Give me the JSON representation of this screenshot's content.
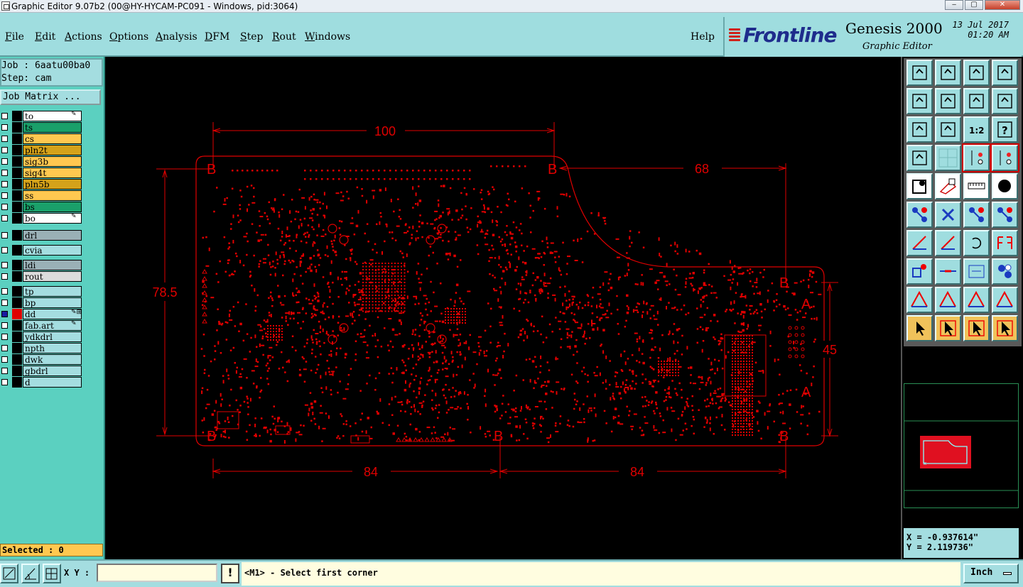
{
  "window": {
    "title": "Graphic Editor 9.07b2 (00@HY-HYCAM-PC091 - Windows, pid:3064)"
  },
  "menu": {
    "items": [
      "File",
      "Edit",
      "Actions",
      "Options",
      "Analysis",
      "DFM",
      "Step",
      "Rout",
      "Windows"
    ],
    "help": "Help"
  },
  "brand": {
    "logo": "Frontline",
    "product": "Genesis 2000",
    "subtitle": "Graphic Editor",
    "date": "13 Jul 2017",
    "time": "01:20 AM"
  },
  "job": {
    "job_label": "Job : 6aatu00ba0",
    "step_label": "Step: cam",
    "matrix_button": "Job Matrix ..."
  },
  "layers": [
    {
      "name": "to",
      "color": "#ffffff",
      "marker": "pencil"
    },
    {
      "name": "ts",
      "color": "#1aa06a",
      "marker": ""
    },
    {
      "name": "cs",
      "color": "#ffc850",
      "marker": ""
    },
    {
      "name": "pln2t",
      "color": "#d4a21a",
      "marker": ""
    },
    {
      "name": "sig3b",
      "color": "#ffc850",
      "marker": ""
    },
    {
      "name": "sig4t",
      "color": "#ffc850",
      "marker": ""
    },
    {
      "name": "pln5b",
      "color": "#d4a21a",
      "marker": ""
    },
    {
      "name": "ss",
      "color": "#ffc850",
      "marker": ""
    },
    {
      "name": "bs",
      "color": "#1aa06a",
      "marker": ""
    },
    {
      "name": "bo",
      "color": "#ffffff",
      "marker": "pencil"
    },
    {
      "name": "drl",
      "color": "#9ab0b6",
      "marker": ""
    },
    {
      "name": "cvia",
      "color": "#a4dde0",
      "marker": ""
    },
    {
      "name": "ldi",
      "color": "#9ab0b6",
      "marker": ""
    },
    {
      "name": "rout",
      "color": "#dcdcdc",
      "marker": ""
    },
    {
      "name": "tp",
      "color": "#a4dde0",
      "marker": ""
    },
    {
      "name": "bp",
      "color": "#a4dde0",
      "marker": ""
    },
    {
      "name": "dd",
      "color": "#a4dde0",
      "marker": "pencil-grid",
      "active": true
    },
    {
      "name": "fab.art",
      "color": "#a4dde0",
      "marker": "pencil"
    },
    {
      "name": "ydkdrl",
      "color": "#a4dde0",
      "marker": ""
    },
    {
      "name": "npth",
      "color": "#a4dde0",
      "marker": ""
    },
    {
      "name": "dwk",
      "color": "#a4dde0",
      "marker": ""
    },
    {
      "name": "gbdrl",
      "color": "#a4dde0",
      "marker": ""
    },
    {
      "name": "d",
      "color": "#a4dde0",
      "marker": ""
    }
  ],
  "selected_label": "Selected : 0",
  "drawing": {
    "dim_top": "100",
    "dim_top_right": "68",
    "dim_left": "78.5",
    "dim_right": "45",
    "dim_bottom_left": "84",
    "dim_bottom_right": "84",
    "marker_b": "B",
    "marker_a": "A",
    "color": "#e00000"
  },
  "coordinates": {
    "x": "X = -0.937614\"",
    "y": "Y = 2.119736\""
  },
  "bottom": {
    "xy_label": "X Y :",
    "xy_value": "",
    "prompt": "<M1> - Select first corner",
    "unit": "Inch"
  },
  "colors": {
    "panel": "#9fdddf",
    "accent": "#5bd0c0",
    "drawing": "#e00000"
  }
}
